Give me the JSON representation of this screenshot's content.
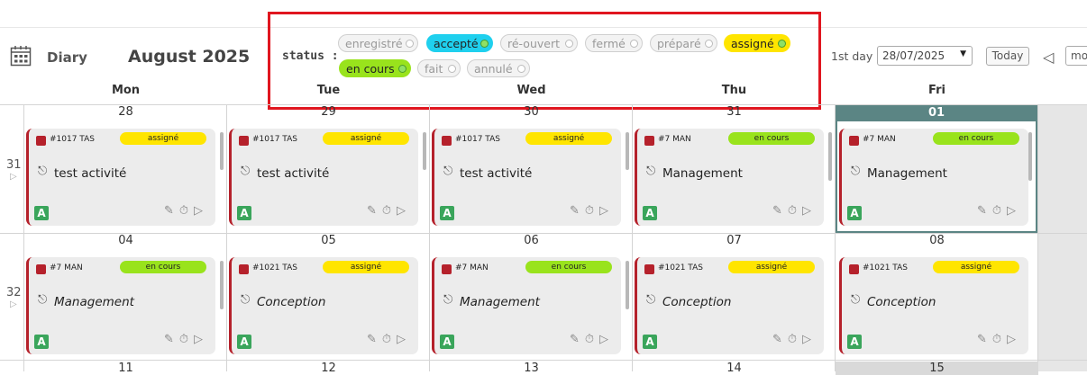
{
  "header": {
    "app_label": "Diary",
    "month_title": "August 2025",
    "status_label": "status :",
    "statuses": [
      {
        "label": "enregistré",
        "active": false,
        "color": "#f3f3f3"
      },
      {
        "label": "accepté",
        "active": true,
        "color": "#1fd0ee"
      },
      {
        "label": "ré-ouvert",
        "active": false,
        "color": "#f3f3f3"
      },
      {
        "label": "fermé",
        "active": false,
        "color": "#f3f3f3"
      },
      {
        "label": "préparé",
        "active": false,
        "color": "#f3f3f3"
      },
      {
        "label": "assigné",
        "active": true,
        "color": "#ffe500"
      },
      {
        "label": "en cours",
        "active": true,
        "color": "#99e31c"
      },
      {
        "label": "fait",
        "active": false,
        "color": "#f3f3f3"
      },
      {
        "label": "annulé",
        "active": false,
        "color": "#f3f3f3"
      }
    ],
    "first_day_label": "1st day",
    "first_day_value": "28/07/2025",
    "today_button": "Today",
    "prev_icon": "chevron-left-icon",
    "mode_select_value": "mo"
  },
  "days_of_week": [
    "Mon",
    "Tue",
    "Wed",
    "Thu",
    "Fri"
  ],
  "colors": {
    "today_header": "#5b8584",
    "task_marker": "#b5212b",
    "avatar": "#3aa55b",
    "status_highlight": "#e0161f"
  },
  "weeks": [
    {
      "number": "31",
      "days": [
        {
          "date": "28",
          "ref": "#1017 TAS",
          "status": "assigné",
          "title": "test activité",
          "avatar": "A",
          "italic": false
        },
        {
          "date": "29",
          "ref": "#1017 TAS",
          "status": "assigné",
          "title": "test activité",
          "avatar": "A",
          "italic": false
        },
        {
          "date": "30",
          "ref": "#1017 TAS",
          "status": "assigné",
          "title": "test activité",
          "avatar": "A",
          "italic": false
        },
        {
          "date": "31",
          "ref": "#7 MAN",
          "status": "en cours",
          "title": "Management",
          "avatar": "A",
          "italic": false
        },
        {
          "date": "01",
          "ref": "#7 MAN",
          "status": "en cours",
          "title": "Management",
          "avatar": "A",
          "italic": false,
          "today": true
        }
      ]
    },
    {
      "number": "32",
      "days": [
        {
          "date": "04",
          "ref": "#7 MAN",
          "status": "en cours",
          "title": "Management",
          "avatar": "A",
          "italic": true
        },
        {
          "date": "05",
          "ref": "#1021 TAS",
          "status": "assigné",
          "title": "Conception",
          "avatar": "A",
          "italic": true
        },
        {
          "date": "06",
          "ref": "#7 MAN",
          "status": "en cours",
          "title": "Management",
          "avatar": "A",
          "italic": true
        },
        {
          "date": "07",
          "ref": "#1021 TAS",
          "status": "assigné",
          "title": "Conception",
          "avatar": "A",
          "italic": true
        },
        {
          "date": "08",
          "ref": "#1021 TAS",
          "status": "assigné",
          "title": "Conception",
          "avatar": "A",
          "italic": true
        }
      ]
    },
    {
      "number": "",
      "days": [
        {
          "date": "11"
        },
        {
          "date": "12"
        },
        {
          "date": "13"
        },
        {
          "date": "14"
        },
        {
          "date": "15"
        }
      ]
    }
  ]
}
